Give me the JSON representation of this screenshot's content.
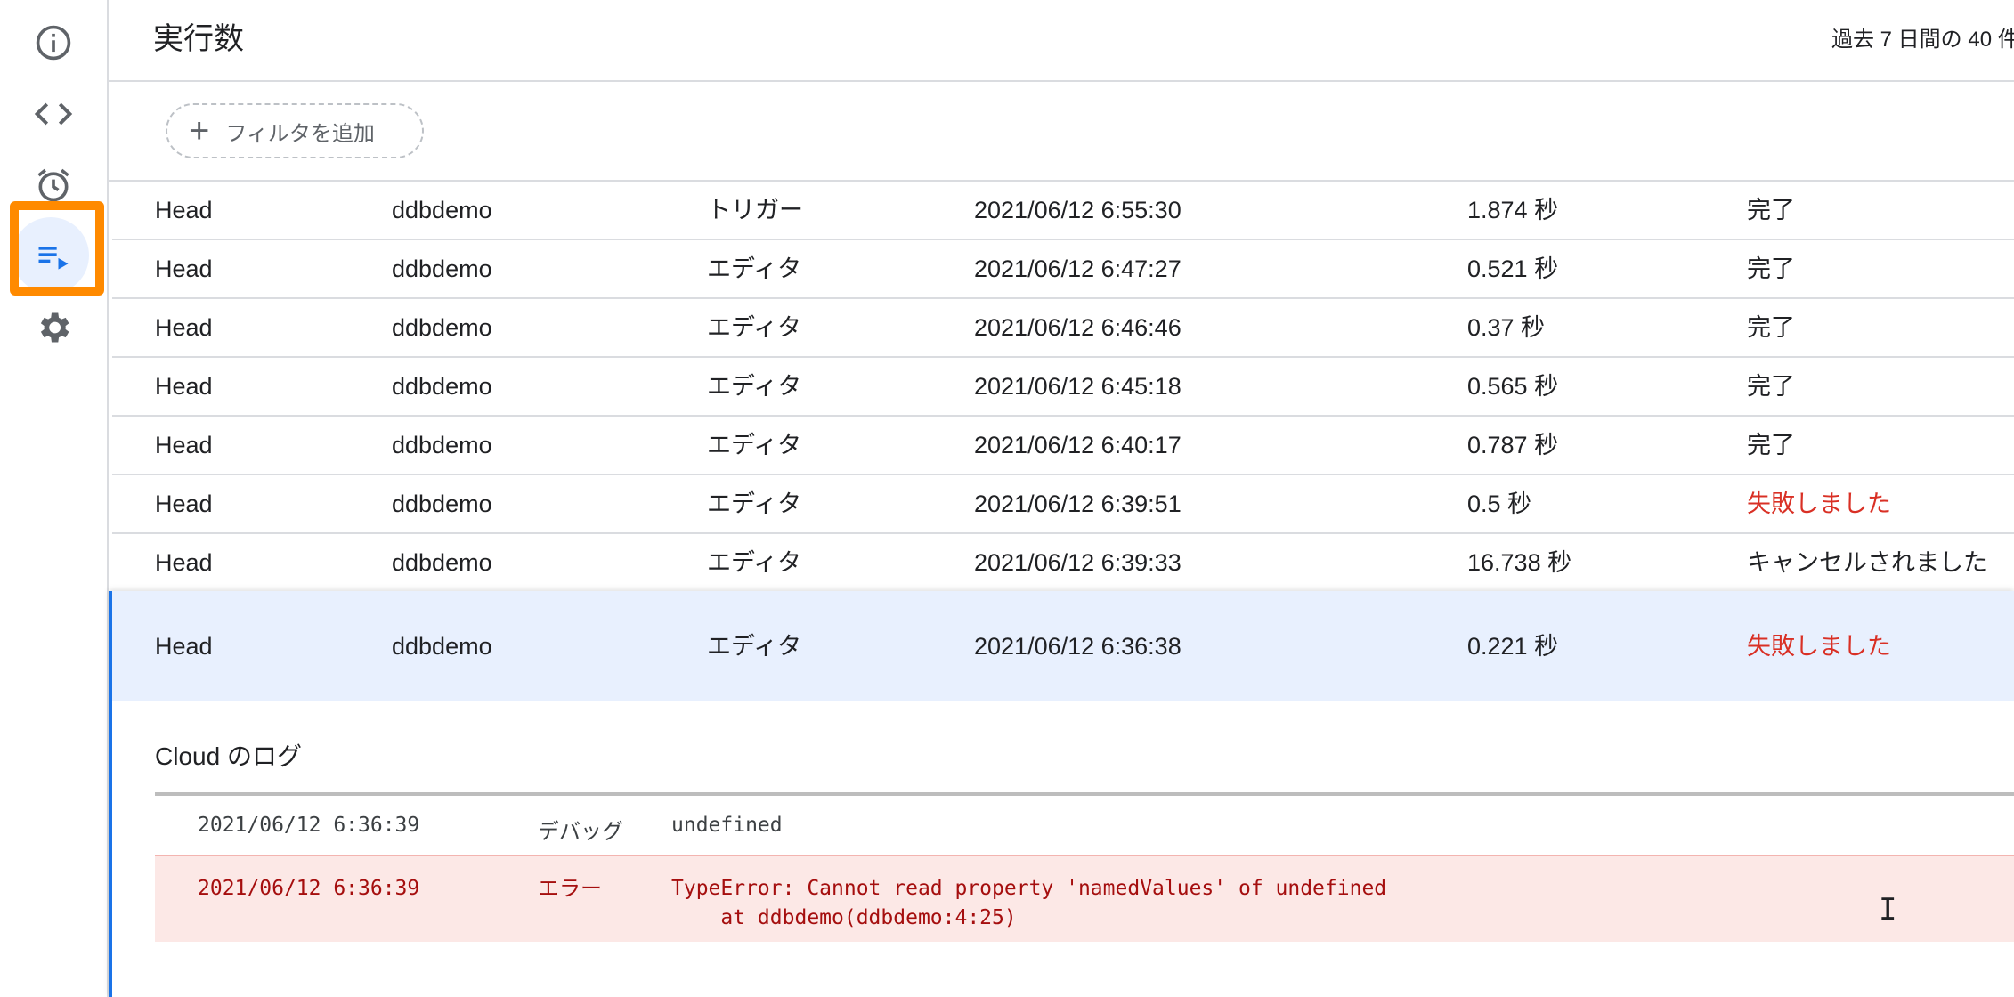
{
  "header": {
    "title": "実行数",
    "info": "過去 7 日間の 40 件"
  },
  "filter": {
    "add_label": "フィルタを追加"
  },
  "nav": {
    "items": [
      {
        "icon": "info-icon"
      },
      {
        "icon": "code-icon"
      },
      {
        "icon": "alarm-clock-icon"
      },
      {
        "icon": "executions-icon",
        "active": true
      },
      {
        "icon": "gear-icon"
      }
    ]
  },
  "executions": [
    {
      "version": "Head",
      "function": "ddbdemo",
      "type": "トリガー",
      "start": "2021/06/12 6:55:30",
      "duration": "1.874 秒",
      "status": "完了",
      "failed": false
    },
    {
      "version": "Head",
      "function": "ddbdemo",
      "type": "エディタ",
      "start": "2021/06/12 6:47:27",
      "duration": "0.521 秒",
      "status": "完了",
      "failed": false
    },
    {
      "version": "Head",
      "function": "ddbdemo",
      "type": "エディタ",
      "start": "2021/06/12 6:46:46",
      "duration": "0.37 秒",
      "status": "完了",
      "failed": false
    },
    {
      "version": "Head",
      "function": "ddbdemo",
      "type": "エディタ",
      "start": "2021/06/12 6:45:18",
      "duration": "0.565 秒",
      "status": "完了",
      "failed": false
    },
    {
      "version": "Head",
      "function": "ddbdemo",
      "type": "エディタ",
      "start": "2021/06/12 6:40:17",
      "duration": "0.787 秒",
      "status": "完了",
      "failed": false
    },
    {
      "version": "Head",
      "function": "ddbdemo",
      "type": "エディタ",
      "start": "2021/06/12 6:39:51",
      "duration": "0.5 秒",
      "status": "失敗しました",
      "failed": true
    },
    {
      "version": "Head",
      "function": "ddbdemo",
      "type": "エディタ",
      "start": "2021/06/12 6:39:33",
      "duration": "16.738 秒",
      "status": "キャンセルされました",
      "failed": false
    }
  ],
  "selected": {
    "version": "Head",
    "function": "ddbdemo",
    "type": "エディタ",
    "start": "2021/06/12 6:36:38",
    "duration": "0.221 秒",
    "status": "失敗しました"
  },
  "logs": {
    "title": "Cloud のログ",
    "entries": [
      {
        "time": "2021/06/12 6:36:39",
        "level": "デバッグ",
        "message": "undefined"
      },
      {
        "time": "2021/06/12 6:36:39",
        "level": "エラー",
        "message": "TypeError: Cannot read property 'namedValues' of undefined\n    at ddbdemo(ddbdemo:4:25)"
      }
    ]
  },
  "colors": {
    "accent": "#1a73e8",
    "error": "#d93025",
    "selected_bg": "#e8f0fe",
    "error_bg": "#fce8e6",
    "highlight": "#ff8a00"
  }
}
